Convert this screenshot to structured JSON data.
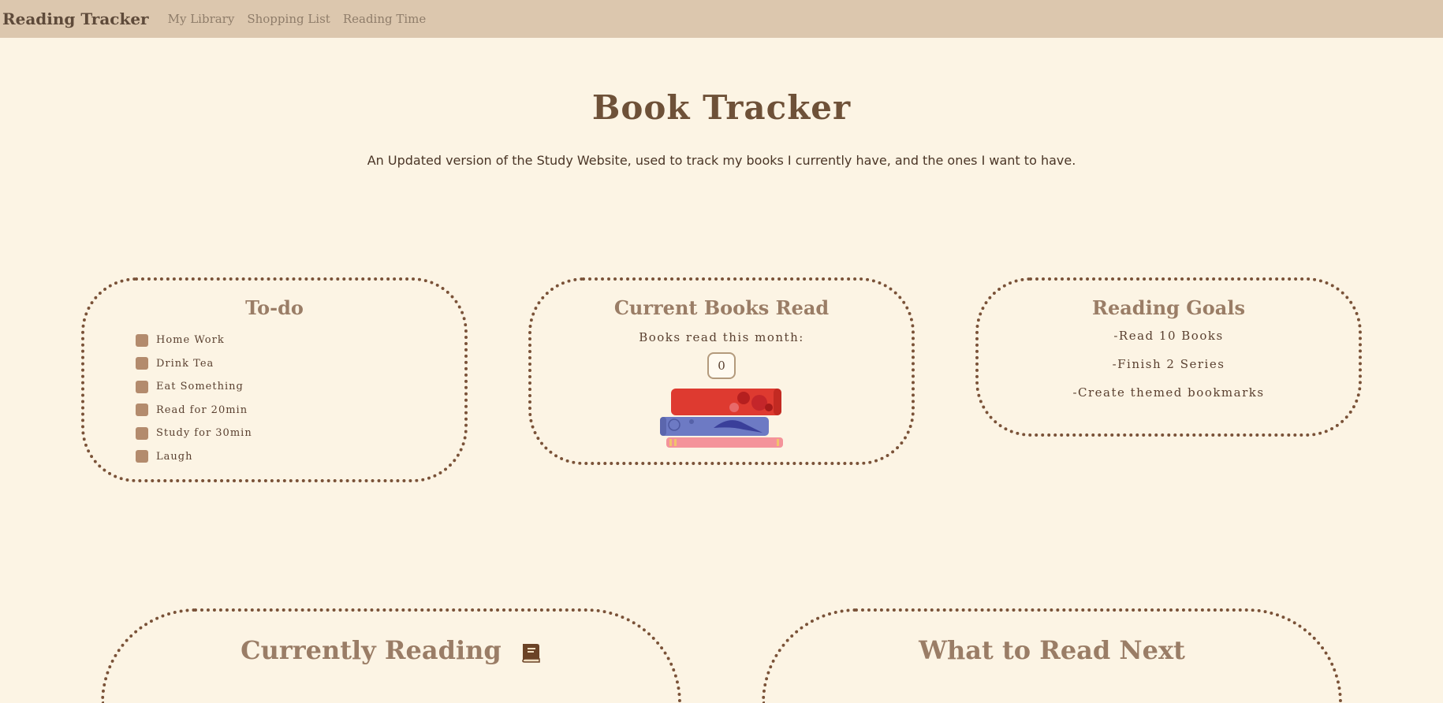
{
  "nav": {
    "brand": "Reading Tracker",
    "links": [
      "My Library",
      "Shopping List",
      "Reading Time"
    ]
  },
  "header": {
    "title": "Book Tracker",
    "subtitle": "An Updated version of the Study Website, used to track my books I currently have, and the ones I want to have."
  },
  "todo": {
    "title": "To-do",
    "items": [
      "Home Work",
      "Drink Tea",
      "Eat Something",
      "Read for 20min",
      "Study for 30min",
      "Laugh"
    ]
  },
  "books_read": {
    "title": "Current Books Read",
    "label": "Books read this month:",
    "count": "0",
    "icon": "book-stack-icon"
  },
  "goals": {
    "title": "Reading Goals",
    "items": [
      "-Read 10 Books",
      "-Finish 2 Series",
      "-Create themed bookmarks"
    ]
  },
  "currently_reading": {
    "title": "Currently Reading",
    "icon": "book-icon"
  },
  "read_next": {
    "title": "What to Read Next"
  },
  "colors": {
    "background": "#fcf4e4",
    "navbar": "#dcc7ae",
    "border": "#7a5238",
    "checkbox": "#b38b6d"
  }
}
